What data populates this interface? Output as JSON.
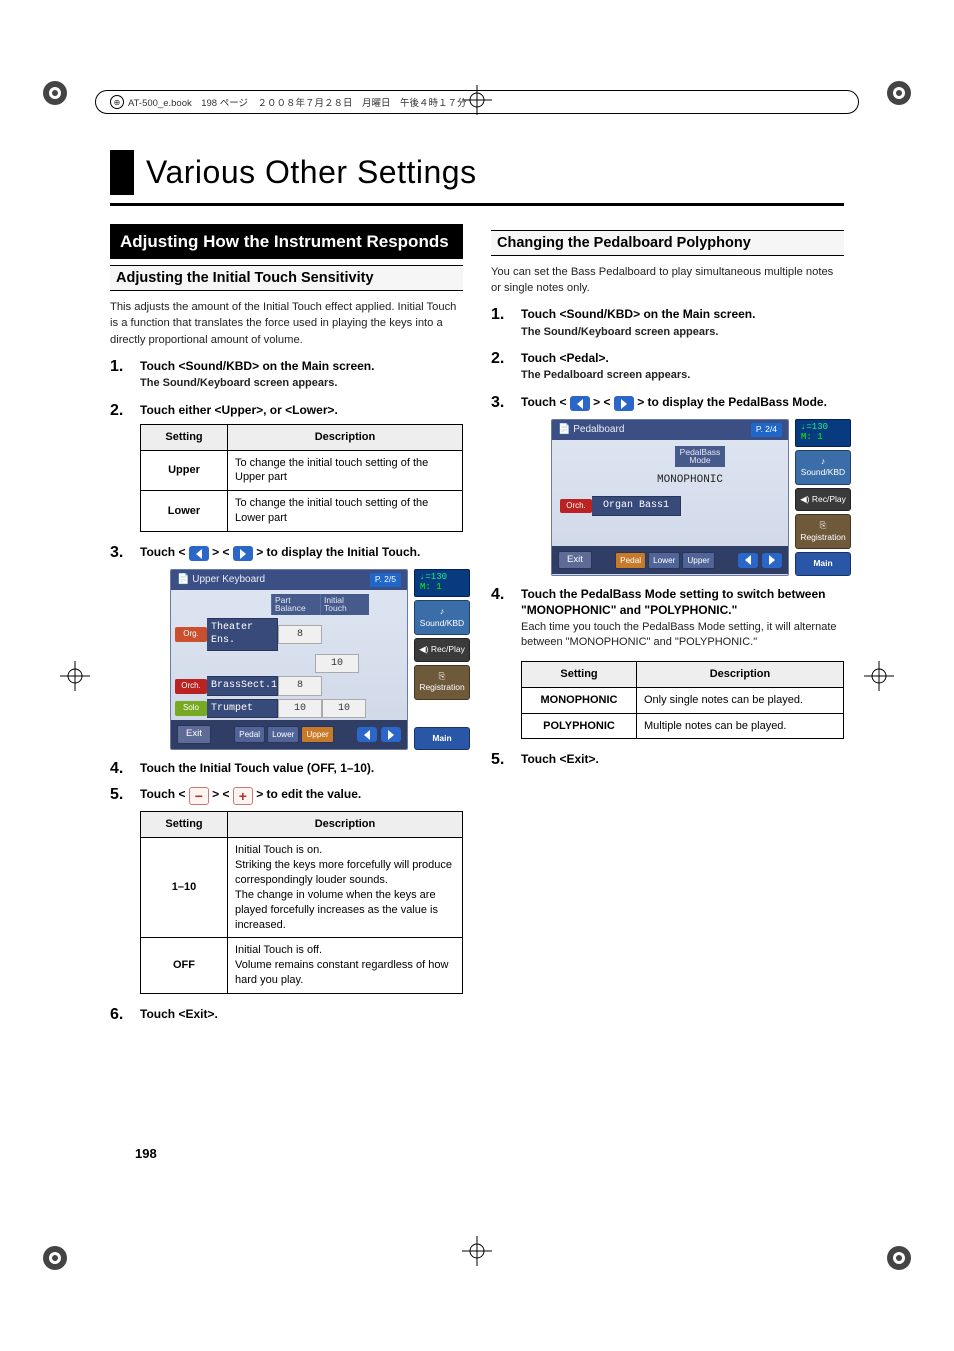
{
  "header_strip": "AT-500_e.book　198 ページ　２００８年７月２８日　月曜日　午後４時１７分",
  "chapter_title": "Various Other Settings",
  "page_number": "198",
  "left": {
    "section_title": "Adjusting How the Instrument Responds",
    "sub1": {
      "title": "Adjusting the Initial Touch Sensitivity",
      "intro": "This adjusts the amount of the Initial Touch effect applied. Initial Touch is a function that translates the force used in playing the keys into a directly proportional amount of volume.",
      "steps": {
        "s1": "Touch <Sound/KBD> on the Main screen.",
        "s1_detail": "The Sound/Keyboard screen appears.",
        "s2": "Touch either <Upper>, or <Lower>.",
        "table1": {
          "h1": "Setting",
          "h2": "Description",
          "rows": [
            {
              "k": "Upper",
              "v": "To change the initial touch setting of the Upper part"
            },
            {
              "k": "Lower",
              "v": "To change the initial touch setting of the Lower part"
            }
          ]
        },
        "s3_pre": "Touch <",
        "s3_mid": "> <",
        "s3_post": "> to display the Initial Touch.",
        "s4": "Touch the Initial Touch value (OFF, 1–10).",
        "s5_pre": "Touch <",
        "s5_mid": "> <",
        "s5_post": "> to edit the value.",
        "table2": {
          "h1": "Setting",
          "h2": "Description",
          "rows": [
            {
              "k": "1–10",
              "v": "Initial Touch is on.\nStriking the keys more forcefully will produce correspondingly louder sounds.\nThe change in volume when the keys are played forcefully increases as the value is increased."
            },
            {
              "k": "OFF",
              "v": "Initial Touch is off.\nVolume remains constant regardless of how hard you play."
            }
          ]
        },
        "s6": "Touch <Exit>."
      },
      "screen": {
        "title": "Upper Keyboard",
        "pagebadge": "P. 2/5",
        "col1": "Part\nBalance",
        "col2": "Initial\nTouch",
        "rows": [
          {
            "tag_class": "tag-org",
            "tag": "Org.",
            "name": "Theater Ens.",
            "c1": "8",
            "c2": ""
          },
          {
            "tag_class": "",
            "tag": "",
            "name": "",
            "c1": "",
            "c2": "10"
          },
          {
            "tag_class": "tag-orch",
            "tag": "Orch.",
            "name": "BrassSect.1",
            "c1": "8",
            "c2": ""
          },
          {
            "tag_class": "tag-solo",
            "tag": "Solo",
            "name": "Trumpet",
            "c1": "10",
            "c2": "10"
          }
        ],
        "exit": "Exit",
        "tabs": [
          "Pedal",
          "Lower",
          "Upper"
        ],
        "tempo": "♩=130",
        "measure": "M:   1",
        "side": {
          "sound": "♪ Sound/KBD",
          "rec": "◀) Rec/Play",
          "reg": "⎘ Registration",
          "main": "Main"
        }
      }
    }
  },
  "right": {
    "sub1": {
      "title": "Changing the Pedalboard Polyphony",
      "intro": "You can set the Bass Pedalboard to play simultaneous multiple notes or single notes only.",
      "steps": {
        "s1": "Touch <Sound/KBD> on the Main screen.",
        "s1_detail": "The Sound/Keyboard screen appears.",
        "s2": "Touch <Pedal>.",
        "s2_detail": "The Pedalboard screen appears.",
        "s3_pre": "Touch <",
        "s3_mid": "> <",
        "s3_post": "> to display the PedalBass Mode.",
        "s4": "Touch the PedalBass Mode setting to switch between \"MONOPHONIC\" and \"POLYPHONIC.\"",
        "s4_detail": "Each time you touch the PedalBass Mode setting, it will alternate between \"MONOPHONIC\" and \"POLYPHONIC.\"",
        "table": {
          "h1": "Setting",
          "h2": "Description",
          "rows": [
            {
              "k": "MONOPHONIC",
              "v": "Only single notes can be played."
            },
            {
              "k": "POLYPHONIC",
              "v": "Multiple notes can be played."
            }
          ]
        },
        "s5": "Touch <Exit>."
      },
      "screen": {
        "title": "Pedalboard",
        "pagebadge": "P. 2/4",
        "label": "PedalBass\nMode",
        "value": "MONOPHONIC",
        "row_tag": "Orch.",
        "row_name": "Organ Bass1",
        "exit": "Exit",
        "tabs": [
          "Pedal",
          "Lower",
          "Upper"
        ],
        "tempo": "♩=130",
        "measure": "M:   1",
        "side": {
          "sound": "♪ Sound/KBD",
          "rec": "◀) Rec/Play",
          "reg": "⎘ Registration",
          "main": "Main"
        }
      }
    }
  }
}
